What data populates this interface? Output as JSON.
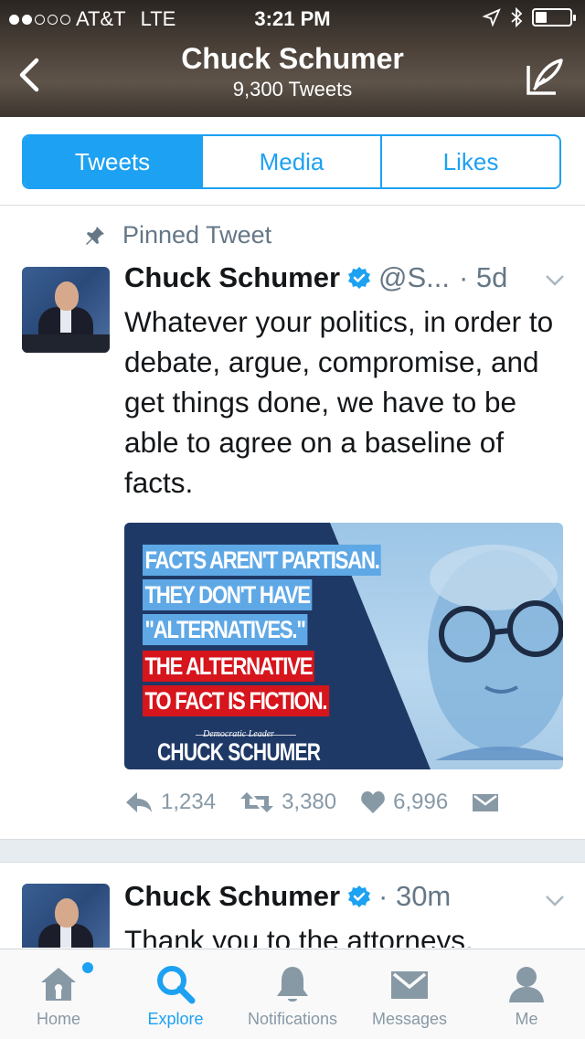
{
  "status_bar": {
    "carrier": "AT&T",
    "network": "LTE",
    "time": "3:21 PM",
    "signal_bars_filled": 2,
    "signal_bars_total": 5
  },
  "header": {
    "title": "Chuck Schumer",
    "subtitle": "9,300 Tweets"
  },
  "tabs": [
    {
      "label": "Tweets",
      "active": true
    },
    {
      "label": "Media",
      "active": false
    },
    {
      "label": "Likes",
      "active": false
    }
  ],
  "pinned_label": "Pinned Tweet",
  "tweets": [
    {
      "name": "Chuck Schumer",
      "handle": "@S...",
      "time": "· 5d",
      "text": "Whatever your politics, in order to debate, argue, compromise, and get things done, we have to be able to agree on a baseline of facts.",
      "media": {
        "lines": [
          "FACTS AREN'T PARTISAN.",
          "THEY DON'T HAVE",
          "\"ALTERNATIVES.\"",
          "THE ALTERNATIVE",
          "TO FACT IS FICTION."
        ],
        "caption_small": "Democratic Leader",
        "caption_big": "CHUCK SCHUMER"
      },
      "replies": "1,234",
      "retweets": "3,380",
      "likes": "6,996"
    },
    {
      "name": "Chuck Schumer",
      "time": "· 30m",
      "text": "Thank you to the attorneys."
    }
  ],
  "bottom_nav": [
    {
      "label": "Home",
      "icon": "home-icon",
      "active": false
    },
    {
      "label": "Explore",
      "icon": "search-icon",
      "active": true
    },
    {
      "label": "Notifications",
      "icon": "bell-icon",
      "active": false
    },
    {
      "label": "Messages",
      "icon": "envelope-icon",
      "active": false
    },
    {
      "label": "Me",
      "icon": "person-icon",
      "active": false
    }
  ],
  "colors": {
    "accent": "#1da1f2",
    "muted": "#657786",
    "verified": "#1da1f2"
  }
}
